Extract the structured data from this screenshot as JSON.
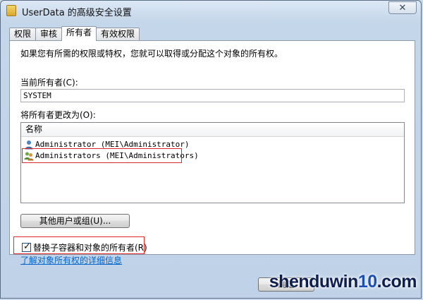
{
  "window": {
    "title": "UserData 的高级安全设置",
    "close_glyph": "✕"
  },
  "tabs": [
    {
      "label": "权限",
      "active": false
    },
    {
      "label": "审核",
      "active": false
    },
    {
      "label": "所有者",
      "active": true
    },
    {
      "label": "有效权限",
      "active": false
    }
  ],
  "owner_page": {
    "intro": "如果您有所需的权限或特权，您就可以取得或分配这个对象的所有权。",
    "current_owner_label": "当前所有者(C):",
    "current_owner_value": "SYSTEM",
    "change_owner_label": "将所有者更改为(O):",
    "list_header": "名称",
    "list_items": [
      {
        "label": "Administrator (MEI\\Administrator)",
        "icon": "user-icon"
      },
      {
        "label": "Administrators (MEI\\Administrators)",
        "icon": "group-icon"
      }
    ],
    "other_users_button": "其他用户或组(U)...",
    "replace_checkbox_label": "替换子容器和对象的所有者(R)",
    "replace_checked": true,
    "learn_more_link": "了解对象所有权的详细信息"
  },
  "footer": {
    "ok_button": "确定"
  },
  "watermark": {
    "brand": "shenduwin",
    "number": "10",
    "tld": ".com"
  },
  "colors": {
    "highlight": "#e0262b",
    "link": "#0066cc"
  }
}
